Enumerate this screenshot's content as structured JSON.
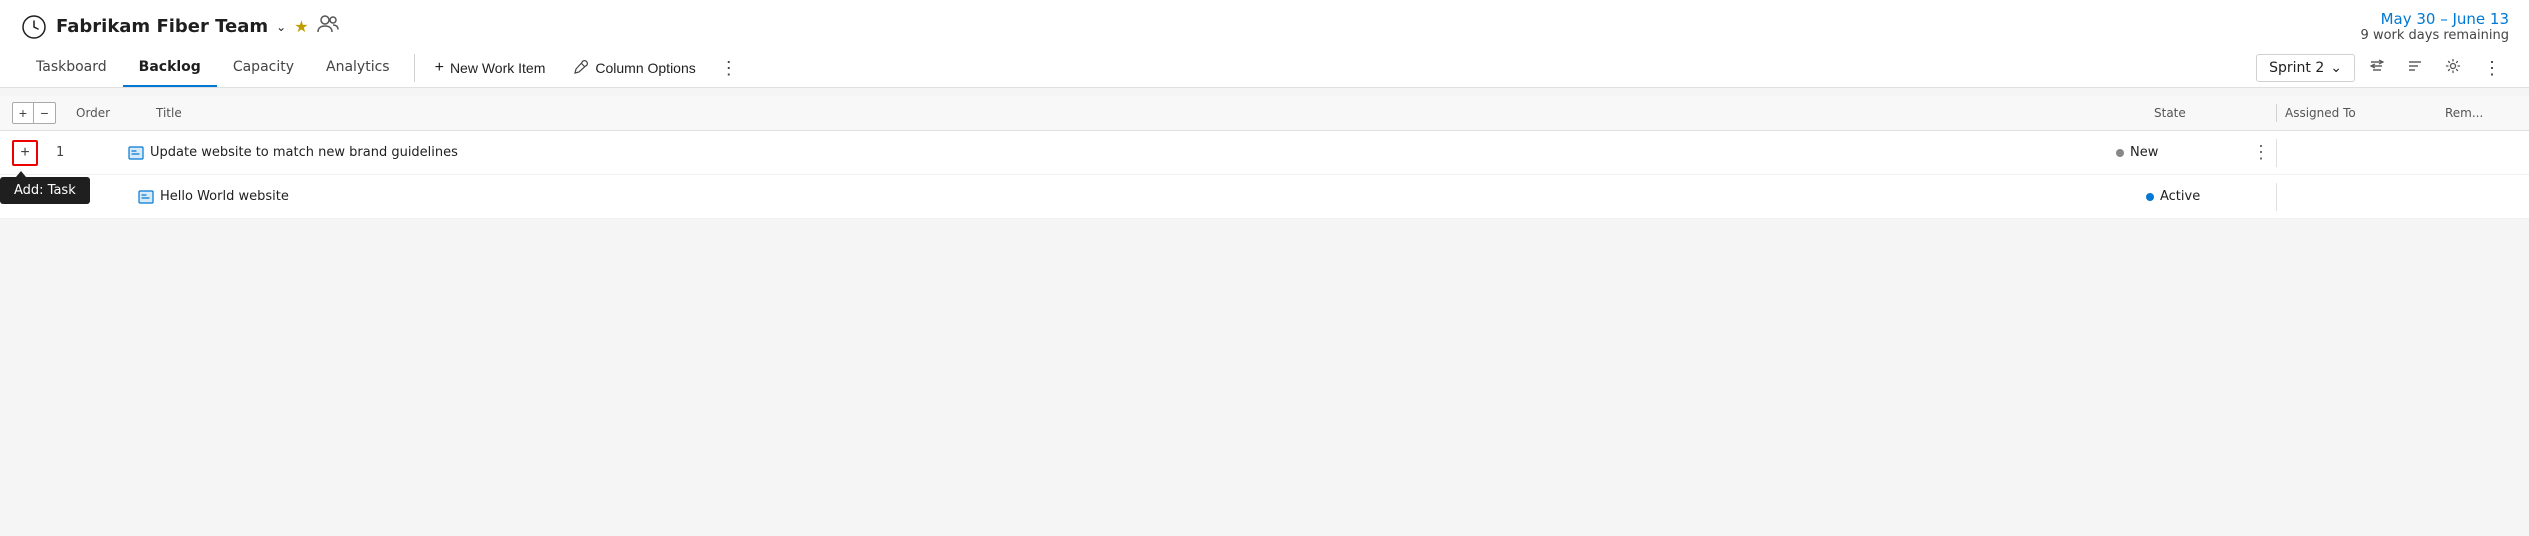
{
  "header": {
    "team_icon": "⏱",
    "team_name": "Fabrikam Fiber Team",
    "chevron": "∨",
    "star": "★",
    "people_icon": "⚇",
    "sprint_dates": "May 30 – June 13",
    "sprint_days": "9 work days remaining"
  },
  "nav": {
    "tabs": [
      {
        "label": "Taskboard",
        "active": false
      },
      {
        "label": "Backlog",
        "active": true
      },
      {
        "label": "Capacity",
        "active": false
      },
      {
        "label": "Analytics",
        "active": false
      }
    ]
  },
  "toolbar": {
    "new_work_item_label": "New Work Item",
    "new_work_item_icon": "+",
    "column_options_label": "Column Options",
    "column_options_icon": "🔧",
    "dots": "⋮",
    "sprint_dropdown_label": "Sprint 2",
    "filter_icon": "⇌",
    "funnel_icon": "≡",
    "gear_icon": "⚙",
    "more_icon": "⋮"
  },
  "table": {
    "expand_btn": "+",
    "collapse_btn": "−",
    "columns": {
      "order": "Order",
      "title": "Title",
      "state": "State",
      "assigned_to": "Assigned To",
      "rem": "Rem..."
    },
    "rows": [
      {
        "order": "1",
        "title": "Update website to match new brand guidelines",
        "state_label": "New",
        "state_color": "gray",
        "assigned_to": "",
        "rem": ""
      },
      {
        "order": "",
        "title": "Hello World website",
        "state_label": "Active",
        "state_color": "blue",
        "assigned_to": "",
        "rem": ""
      }
    ],
    "add_btn_label": "+",
    "tooltip": "Add: Task"
  }
}
